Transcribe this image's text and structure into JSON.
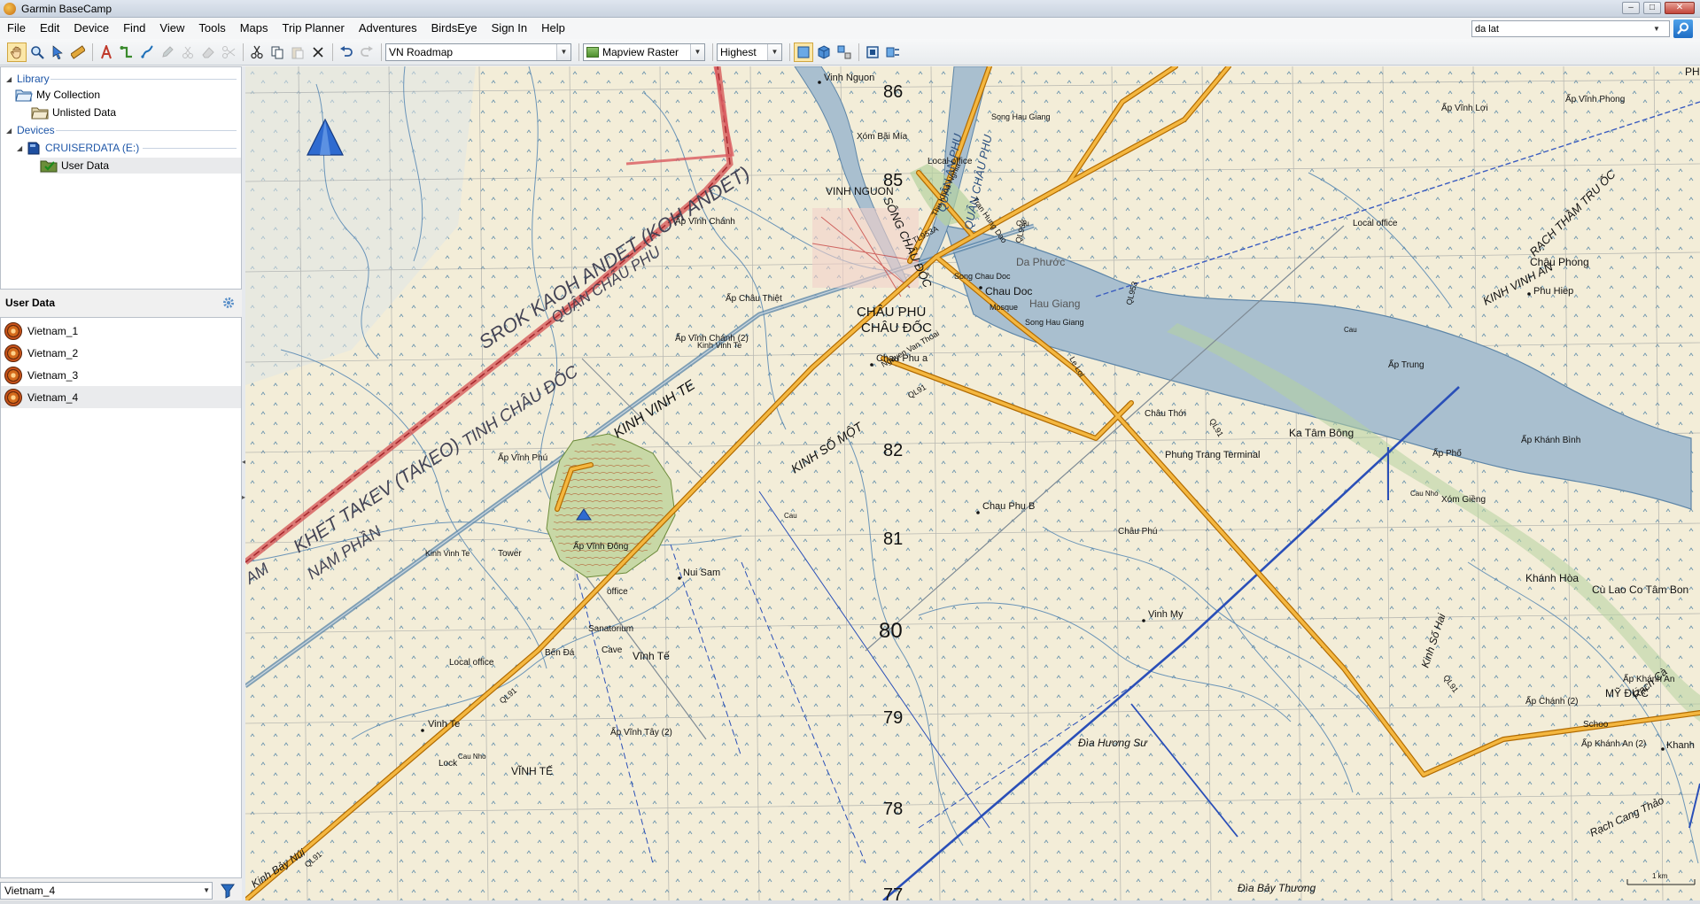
{
  "window": {
    "title": "Garmin BaseCamp",
    "minimize": "–",
    "maximize": "□",
    "close": "✕"
  },
  "menu": [
    "File",
    "Edit",
    "Device",
    "Find",
    "View",
    "Tools",
    "Maps",
    "Trip Planner",
    "Adventures",
    "BirdsEye",
    "Sign In",
    "Help"
  ],
  "search": {
    "value": "da lat"
  },
  "toolbar": {
    "map_product": "VN Roadmap",
    "map_layer": "Mapview Raster",
    "detail": "Highest"
  },
  "library": {
    "title": "Library",
    "my_collection": "My Collection",
    "unlisted": "Unlisted Data",
    "devices_title": "Devices",
    "device": "CRUISERDATA (E:)",
    "user_data": "User Data"
  },
  "user_data_panel": {
    "title": "User Data",
    "items": [
      "Vietnam_1",
      "Vietnam_2",
      "Vietnam_3",
      "Vietnam_4"
    ],
    "selected": "Vietnam_4"
  },
  "map": {
    "grid_numbers": [
      "86",
      "85",
      "82",
      "81",
      "80",
      "79",
      "78",
      "77"
    ],
    "labels": {
      "vinh_nguon": "Vinh Nguon",
      "vinh_nguon_big": "VINH NGUON",
      "xom_bai_mia": "Xóm Bãi Mía",
      "song_chau_doc": "SÔNG CHÂU ĐỐC",
      "quan_an_phu": "QUẬN AN PHU",
      "quan_chau_phu_river": "QUẬN CHÂU PHU",
      "ap_vinh_loi": "Ấp Vĩnh Lợi",
      "ap_vinh_phong": "Ấp Vĩnh Phong",
      "phong": "PHONG",
      "kinh_vinh_an": "KINH VINH AN",
      "rach_tham_tru_oc": "RẠCH THẦM TRU ỐC",
      "chau_phong": "Châu Phong",
      "song_hau_giang_top": "Song Hau Giang",
      "local_office": "Local office",
      "ap_vinh_chanh": "Ấp Vĩnh Chánh",
      "thu_khoa_nghia": "Thu Khoa Nghia",
      "tran_hung_dao": "Tran Hung Dao",
      "ql953": "QL953",
      "tl953a": "TL953A",
      "da_phuoc": "Da Phước",
      "song_chau_doc_small": "Song Chau Doc",
      "chau_doc": "Chau Doc",
      "mosque": "Mosque",
      "hau_giang": "Hau Giang",
      "ap_trung": "Ấp Trung",
      "cau": "Cau",
      "song_hau_giang": "Song Hau Giang",
      "phu_hiep": "Phu Hiep",
      "chau_phu_big": "CHÂU PHU",
      "chau_doc_big": "CHÂU ĐỐC",
      "ap_chau_thiet": "Ấp Châu Thiệt",
      "nguyen_van_thoai": "Nguyen Van Thoai",
      "chau_phu_a": "Chau Phu a",
      "ql91": "QL91",
      "le_loi": "Le Loi",
      "chau_thoi": "Châu Thới",
      "kinh_vinh_te_small": "Kinh Vinh Te",
      "ap_vinh_chanh_2": "Ấp Vĩnh Chánh (2)",
      "srok_kaoh": "SROK KAOH ANDET (KOH ANDET)",
      "quan_chau_phu": "QUẬN CHÂU PHU",
      "tinh_chau_doc": "TINH CHÂU ĐỐC",
      "khet_takev": "KHET TAKEV (TAKEO)",
      "nam_phan": "NAM PHẦN",
      "am": "AM",
      "kinh_vinh_te": "KINH VINH TE",
      "kinh_so_mot": "KINH SỐ MỘT",
      "ap_vinh_phu": "Ấp Vĩnh Phú",
      "ap_vinh_dong": "Ấp Vĩnh Đông",
      "nui_sam": "Nui Sam",
      "office": "office",
      "sanatorium": "Sanatorium",
      "cave": "Cave",
      "ben_da": "Bến Đá",
      "vinh_te": "Vinh Te",
      "vinh_te_2": "Vĩnh Tế",
      "vinh_te_big": "VĨNH TẾ",
      "ap_vinh_tay": "Ấp Vĩnh Tây (2)",
      "cau_nho": "Cau Nho",
      "lock": "Lock",
      "kinh_vinh_te_left": "Kinh Vinh Te",
      "tower": "Tower",
      "chau_phu_b": "Chau Phu B",
      "chau_phu_small": "Châu Phú",
      "vinh_my": "Vinh My",
      "phung_trang": "Phung Trang Terminal",
      "ka_tam_bong": "Ka Tâm Bông",
      "ap_khanh_binh": "Ấp Khánh Bình",
      "ap_pho": "Ấp Phố",
      "xom_gieng": "Xóm Giềng",
      "khanh_hoa": "Khánh Hòa",
      "cu_lao": "Cù Lao Co Tâm Bon",
      "kinh_so_hai": "Kinh Số Hai",
      "my_duc": "MỸ ĐỨC",
      "rach_ca": "Rạch Cà",
      "ap_khanh_an": "Ấp Khánh An",
      "ap_chanh_2": "Ấp Chánh (2)",
      "khanh": "Khanh",
      "schoo": "Schoo",
      "ap_khanh_an_2": "Ấp Khánh An (2)",
      "rach_cang_thao": "Rạch Cang Thảo",
      "da_huong_su": "Đìa Hương Sư",
      "da_bay_thuong": "Đìa Bảy Thương",
      "kinh_bay_nui": "Kinh Bảy Núi",
      "scale": "1 km"
    }
  }
}
